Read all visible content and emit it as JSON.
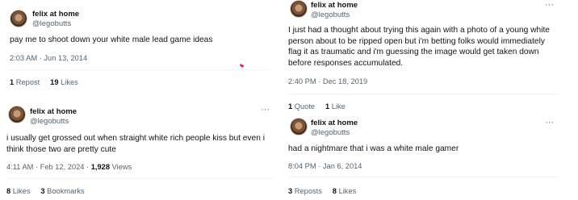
{
  "tweets": [
    {
      "author": "felix at home",
      "handle": "@legobutts",
      "text": "pay me to shoot down your white male lead game ideas",
      "time": "2:03 AM · Jun 13, 2014",
      "views": "",
      "stats": [
        {
          "num": "1",
          "label": "Repost"
        },
        {
          "num": "19",
          "label": "Likes"
        }
      ]
    },
    {
      "author": "felix at home",
      "handle": "@legobutts",
      "text": "i usually get grossed out when straight white rich people kiss but even i think those two are pretty cute",
      "time": "4:11 AM · Feb 12, 2024 · ",
      "views_num": "1,928",
      "views_label": " Views",
      "stats": [
        {
          "num": "8",
          "label": "Likes"
        },
        {
          "num": "3",
          "label": "Bookmarks"
        }
      ]
    },
    {
      "author": "felix at home",
      "handle": "@legobutts",
      "text": "I just had a thought about trying this again with a photo of a young white person about to be ripped open but i'm betting folks would immediately flag it as traumatic and i'm guessing the image would get taken down before responses accumulated.",
      "time": "2:40 PM · Dec 18, 2019",
      "stats": [
        {
          "num": "1",
          "label": "Quote"
        },
        {
          "num": "1",
          "label": "Like"
        }
      ]
    },
    {
      "author": "felix at home",
      "handle": "@legobutts",
      "text": "had a nightmare that i was a white male gamer",
      "time": "8:04 PM · Jan 6, 2014",
      "stats": [
        {
          "num": "3",
          "label": "Reposts"
        },
        {
          "num": "8",
          "label": "Likes"
        }
      ]
    }
  ],
  "more_icon": "···",
  "colors": {
    "text": "#0f1419",
    "secondary": "#536471",
    "divider": "#eff3f4",
    "accent_dot": "#e0245e"
  }
}
